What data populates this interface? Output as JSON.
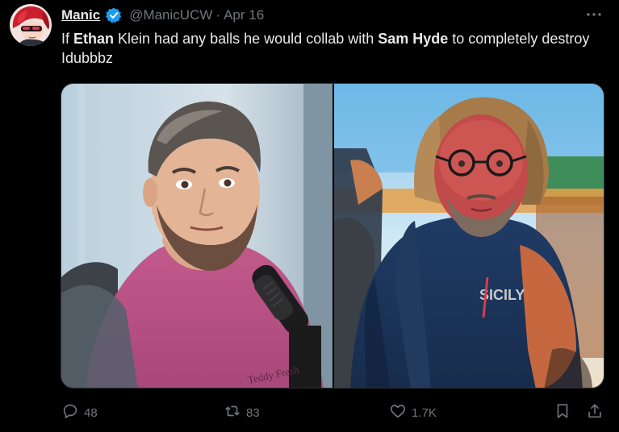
{
  "author": {
    "display_name": "Manic",
    "handle": "@ManicUCW",
    "separator": "·",
    "date": "Apr 16"
  },
  "tweet": {
    "parts": [
      {
        "text": "If ",
        "bold": false
      },
      {
        "text": "Ethan",
        "bold": true
      },
      {
        "text": " Klein had any balls he would collab with ",
        "bold": false
      },
      {
        "text": "Sam Hyde",
        "bold": true
      },
      {
        "text": " to completely destroy Idubbbz",
        "bold": false
      }
    ]
  },
  "media": {
    "left_shirt_text": "Teddy Fresh",
    "right_shirt_text": "SICILY"
  },
  "metrics": {
    "replies": "48",
    "retweets": "83",
    "likes": "1.7K"
  },
  "icons": {
    "verified": "verified-badge-icon",
    "more": "more-options-icon",
    "reply": "reply-icon",
    "retweet": "retweet-icon",
    "like": "heart-icon",
    "bookmark": "bookmark-icon",
    "share": "share-icon"
  },
  "colors": {
    "background": "#000000",
    "text_primary": "#e7e9ea",
    "text_secondary": "#71767b",
    "verified_blue": "#1d9bf0",
    "border": "#2f3336"
  }
}
